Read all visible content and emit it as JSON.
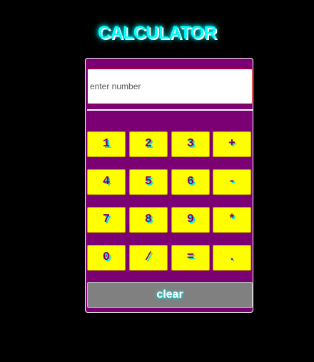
{
  "app": {
    "title": "CALCULATOR"
  },
  "display": {
    "placeholder": "enter number",
    "value": ""
  },
  "keypad": {
    "rows": [
      [
        "1",
        "2",
        "3",
        "+"
      ],
      [
        "4",
        "5",
        "6",
        "-"
      ],
      [
        "7",
        "8",
        "9",
        "*"
      ],
      [
        "0",
        "/",
        "=",
        "."
      ]
    ]
  },
  "clear_label": "clear",
  "colors": {
    "page_background": "#000000",
    "panel": "#7a0073",
    "key_background": "#ffff00",
    "key_text": "#7a0073",
    "title": "#00ffff",
    "clear_background": "#808080"
  }
}
